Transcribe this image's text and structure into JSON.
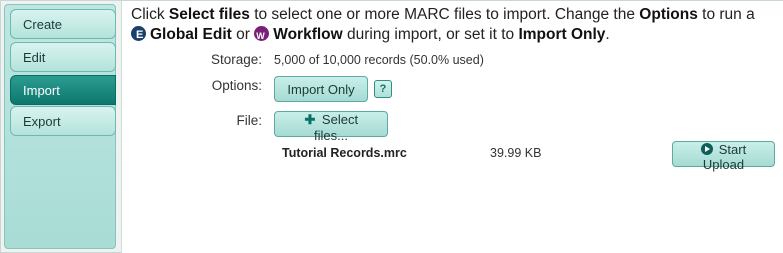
{
  "sidebar": {
    "items": [
      {
        "label": "Create"
      },
      {
        "label": "Edit"
      },
      {
        "label": "Import"
      },
      {
        "label": "Export"
      }
    ],
    "active": "Import"
  },
  "intro": {
    "t1": "Click ",
    "b1": "Select files",
    "t2": " to select one or more MARC files to import. Change the ",
    "b2": "Options",
    "t3": " to run a ",
    "b3": "Global Edit",
    "t4": " or ",
    "b4": "Workflow",
    "t5": " during import, or set it to ",
    "b5": "Import Only",
    "t6": "."
  },
  "storage": {
    "label": "Storage:",
    "value": "5,000 of 10,000 records (50.0% used)"
  },
  "options": {
    "label": "Options:",
    "button": "Import Only",
    "help": "?"
  },
  "file": {
    "label": "File:",
    "select_button": "Select files...",
    "name": "Tutorial Records.mrc",
    "size": "39.99 KB",
    "upload_button": "Start Upload"
  },
  "colors": {
    "accent": "#0d776e",
    "tab_bg": "#b4e3dc"
  }
}
